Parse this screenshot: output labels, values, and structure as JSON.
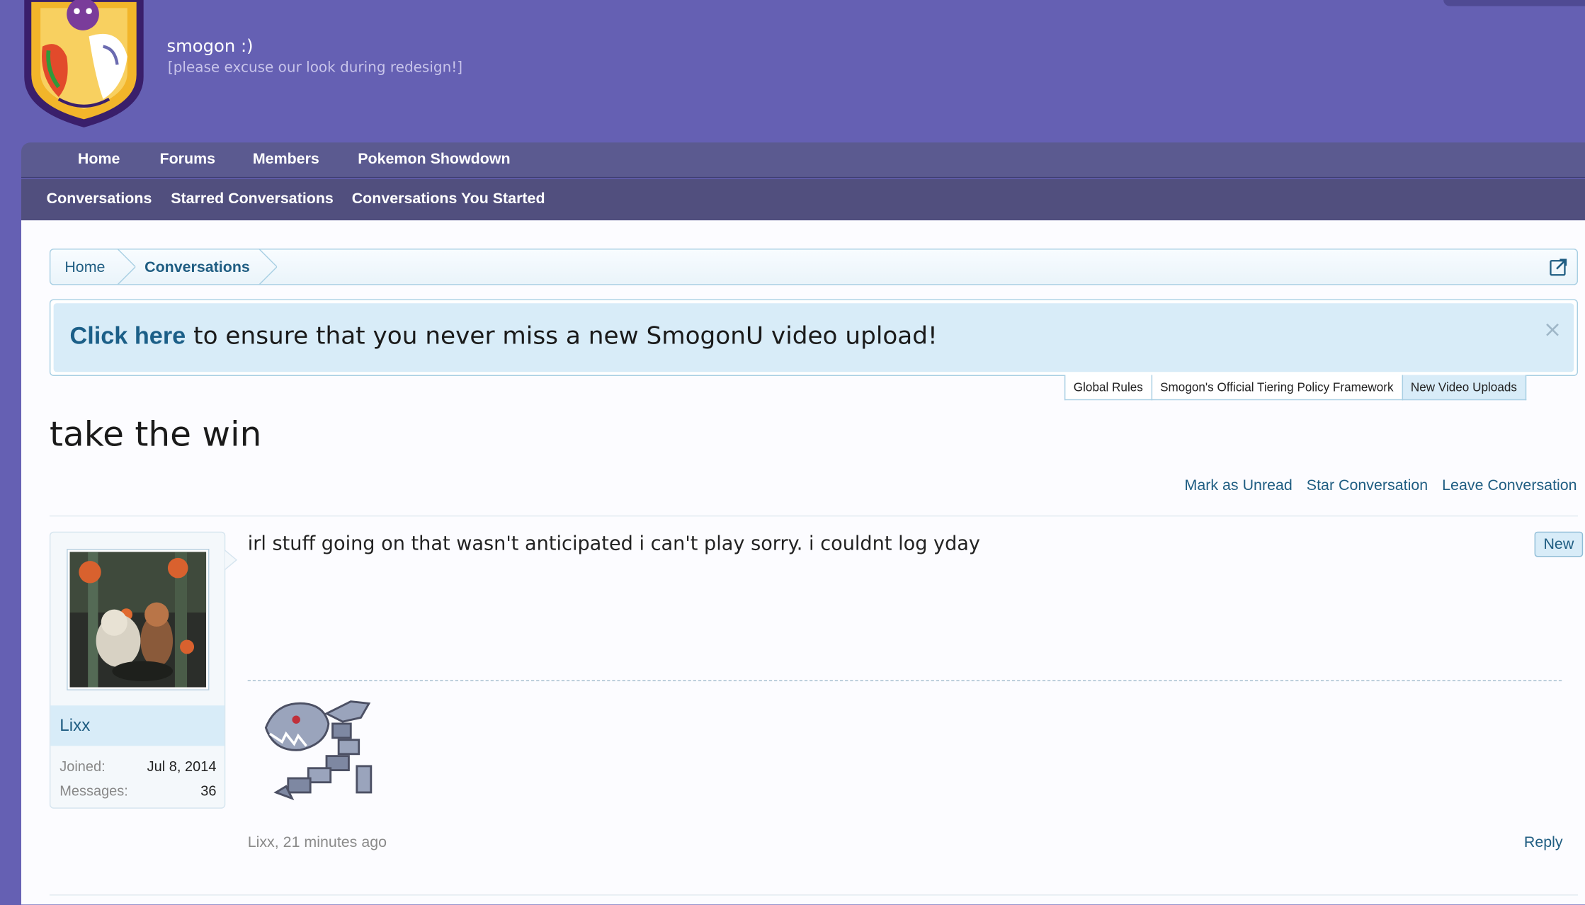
{
  "header": {
    "site_title": "smogon :)",
    "site_subtitle": "[please excuse our look during redesign!]"
  },
  "nav": {
    "items": [
      "Home",
      "Forums",
      "Members",
      "Pokemon Showdown"
    ]
  },
  "subnav": {
    "items": [
      "Conversations",
      "Starred Conversations",
      "Conversations You Started"
    ]
  },
  "breadcrumb": {
    "items": [
      "Home",
      "Conversations"
    ]
  },
  "notice": {
    "link_text": "Click here",
    "text": " to ensure that you never miss a new SmogonU video upload!",
    "close": "×"
  },
  "notice_tabs": [
    "Global Rules",
    "Smogon's Official Tiering Policy Framework",
    "New Video Uploads"
  ],
  "thread": {
    "title": "take the win",
    "actions": [
      "Mark as Unread",
      "Star Conversation",
      "Leave Conversation"
    ]
  },
  "message": {
    "author": "Lixx",
    "joined_label": "Joined:",
    "joined_value": "Jul 8, 2014",
    "messages_label": "Messages:",
    "messages_value": "36",
    "text": "irl stuff going on that wasn't anticipated i can't play sorry. i couldnt log yday",
    "badge": "New",
    "meta": "Lixx, 21 minutes ago",
    "reply_label": "Reply"
  },
  "colors": {
    "background": "#6560b3",
    "nav": "#5b5a90",
    "subnav": "#514f7e",
    "link": "#1f5d82",
    "notice_bg": "#d8ecf8"
  }
}
